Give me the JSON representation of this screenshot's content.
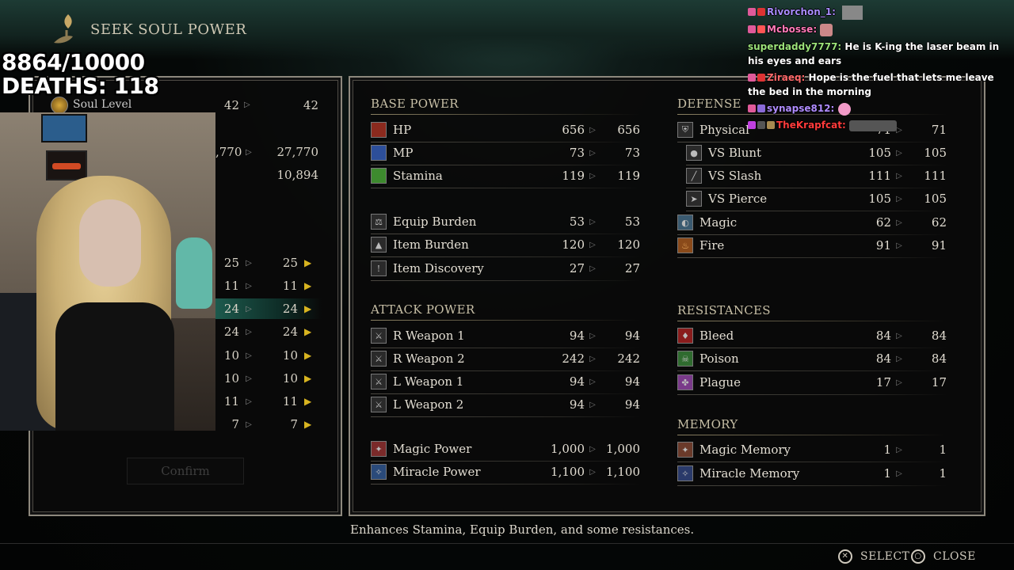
{
  "header": {
    "title": "SEEK SOUL POWER"
  },
  "overlay": {
    "progress": "8864/10000",
    "deaths": "DEATHS: 118"
  },
  "chat": [
    {
      "user": "Rivorchon_1:",
      "user_color": "#a78bfa",
      "text": ""
    },
    {
      "user": "Mcbosse:",
      "user_color": "#ff7ab8",
      "text": ""
    },
    {
      "user": "superdaddy7777:",
      "user_color": "#9be37a",
      "text": "He is K-ing the laser beam in his eyes and ears"
    },
    {
      "user": "Ziraeq:",
      "user_color": "#ff6a6a",
      "text": "Hope is the fuel that lets me leave the bed in the morning"
    },
    {
      "user": "synapse812:",
      "user_color": "#b08cff",
      "text": ""
    },
    {
      "user": "TheKrapfcat:",
      "user_color": "#ff3b3b",
      "text": ""
    }
  ],
  "left_panel": {
    "soul_level": {
      "label": "Soul Level",
      "current": "42",
      "next": "42"
    },
    "souls": {
      "current": ",770",
      "next": "27,770"
    },
    "required": "10,894",
    "stats": [
      {
        "current": "25",
        "next": "25"
      },
      {
        "current": "11",
        "next": "11"
      },
      {
        "current": "24",
        "next": "24",
        "selected": true
      },
      {
        "current": "24",
        "next": "24"
      },
      {
        "current": "10",
        "next": "10"
      },
      {
        "current": "10",
        "next": "10"
      },
      {
        "current": "11",
        "next": "11"
      },
      {
        "current": "7",
        "next": "7"
      }
    ],
    "confirm_label": "Confirm"
  },
  "base_power": {
    "title": "BASE POWER",
    "rows": [
      {
        "label": "HP",
        "icon": "hp-icon",
        "color": "#8b2a1e",
        "current": "656",
        "next": "656"
      },
      {
        "label": "MP",
        "icon": "mp-icon",
        "color": "#2d4f9a",
        "current": "73",
        "next": "73"
      },
      {
        "label": "Stamina",
        "icon": "stamina-icon",
        "color": "#3d8a2e",
        "current": "119",
        "next": "119"
      },
      {
        "label": "Equip Burden",
        "icon": "equip-burden-icon",
        "color": "#5a5040",
        "current": "53",
        "next": "53"
      },
      {
        "label": "Item Burden",
        "icon": "item-burden-icon",
        "color": "#5a5040",
        "current": "120",
        "next": "120"
      },
      {
        "label": "Item Discovery",
        "icon": "item-discovery-icon",
        "color": "#5a5040",
        "current": "27",
        "next": "27"
      }
    ]
  },
  "attack_power": {
    "title": "ATTACK POWER",
    "rows": [
      {
        "label": "R Weapon 1",
        "icon": "sword-icon",
        "color": "#5a5040",
        "current": "94",
        "next": "94"
      },
      {
        "label": "R Weapon 2",
        "icon": "sword-icon",
        "color": "#5a5040",
        "current": "242",
        "next": "242"
      },
      {
        "label": "L Weapon 1",
        "icon": "sword-icon",
        "color": "#5a5040",
        "current": "94",
        "next": "94"
      },
      {
        "label": "L Weapon 2",
        "icon": "sword-icon",
        "color": "#5a5040",
        "current": "94",
        "next": "94"
      },
      {
        "label": "Magic Power",
        "icon": "magic-power-icon",
        "color": "#7a2a2a",
        "current": "1,000",
        "next": "1,000"
      },
      {
        "label": "Miracle Power",
        "icon": "miracle-power-icon",
        "color": "#2a4a7a",
        "current": "1,100",
        "next": "1,100"
      }
    ]
  },
  "defense": {
    "title": "DEFENSE",
    "rows": [
      {
        "label": "Physical",
        "icon": "physical-icon",
        "current": "71",
        "next": "71",
        "indent": false
      },
      {
        "label": "VS Blunt",
        "icon": "blunt-icon",
        "current": "105",
        "next": "105",
        "indent": true
      },
      {
        "label": "VS Slash",
        "icon": "slash-icon",
        "current": "111",
        "next": "111",
        "indent": true
      },
      {
        "label": "VS Pierce",
        "icon": "pierce-icon",
        "current": "105",
        "next": "105",
        "indent": true
      },
      {
        "label": "Magic",
        "icon": "magic-defense-icon",
        "current": "62",
        "next": "62",
        "indent": false
      },
      {
        "label": "Fire",
        "icon": "fire-icon",
        "current": "91",
        "next": "91",
        "indent": false
      }
    ]
  },
  "resistances": {
    "title": "RESISTANCES",
    "rows": [
      {
        "label": "Bleed",
        "icon": "bleed-icon",
        "color": "#8a1c1c",
        "current": "84",
        "next": "84"
      },
      {
        "label": "Poison",
        "icon": "poison-icon",
        "color": "#2f6b2f",
        "current": "84",
        "next": "84"
      },
      {
        "label": "Plague",
        "icon": "plague-icon",
        "color": "#7a3a8a",
        "current": "17",
        "next": "17"
      }
    ]
  },
  "memory": {
    "title": "MEMORY",
    "rows": [
      {
        "label": "Magic Memory",
        "icon": "magic-memory-icon",
        "current": "1",
        "next": "1"
      },
      {
        "label": "Miracle Memory",
        "icon": "miracle-memory-icon",
        "current": "1",
        "next": "1"
      }
    ]
  },
  "description": "Enhances Stamina, Equip Burden, and some resistances.",
  "footer": {
    "select_label": "SELECT",
    "close_label": "CLOSE"
  }
}
